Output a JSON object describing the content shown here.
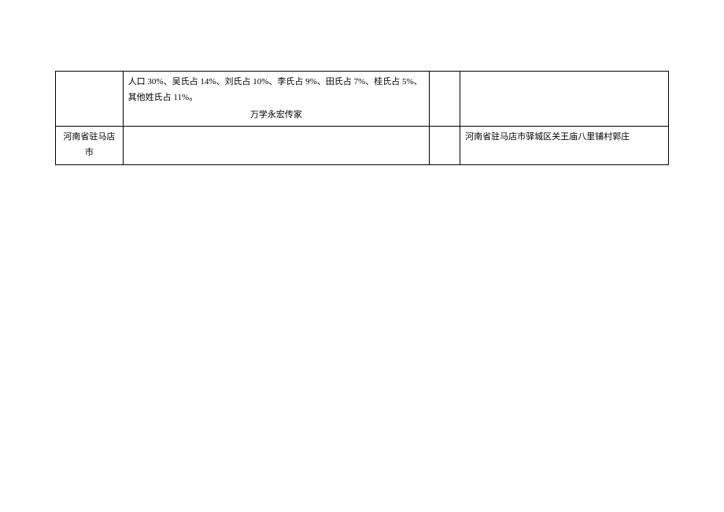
{
  "table": {
    "rows": [
      {
        "col1": "",
        "col2_line1": "人口 30%、吴氏占 14%、刘氏占 10%、李氏占 9%、田氏占 7%、桂氏占 5%、其他姓氏占 11%。",
        "col2_signature": "万学永宏传家",
        "col3": "",
        "col4": ""
      },
      {
        "col1": "河南省驻马店市",
        "col2": "",
        "col3": "",
        "col4": "河南省驻马店市驿城区关王庙八里铺村郭庄"
      }
    ]
  }
}
